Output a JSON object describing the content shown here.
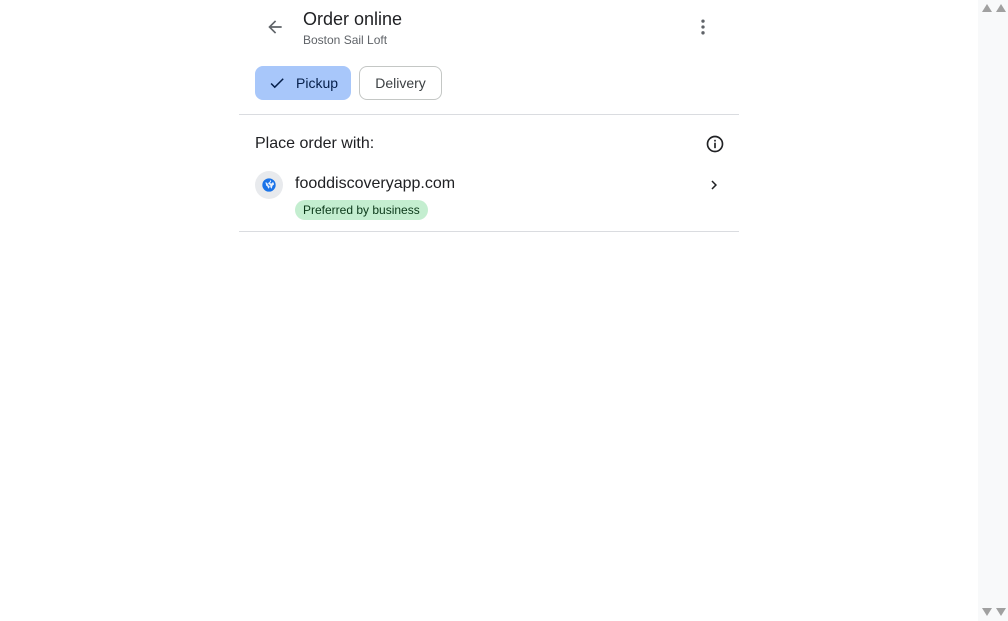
{
  "header": {
    "title": "Order online",
    "subtitle": "Boston Sail Loft",
    "back_icon": "arrow-back-icon",
    "more_icon": "more-vert-icon"
  },
  "chips": {
    "pickup_label": "Pickup",
    "pickup_selected": true,
    "delivery_label": "Delivery"
  },
  "section": {
    "label": "Place order with:",
    "info_icon": "info-icon"
  },
  "providers": [
    {
      "name": "fooddiscoveryapp.com",
      "badge": "Preferred by business",
      "icon": "globe-icon"
    }
  ],
  "colors": {
    "chip_selected_bg": "#a8c7fa",
    "badge_bg": "#c4eed0",
    "globe_icon": "#1a73e8",
    "divider": "#dadce0"
  }
}
